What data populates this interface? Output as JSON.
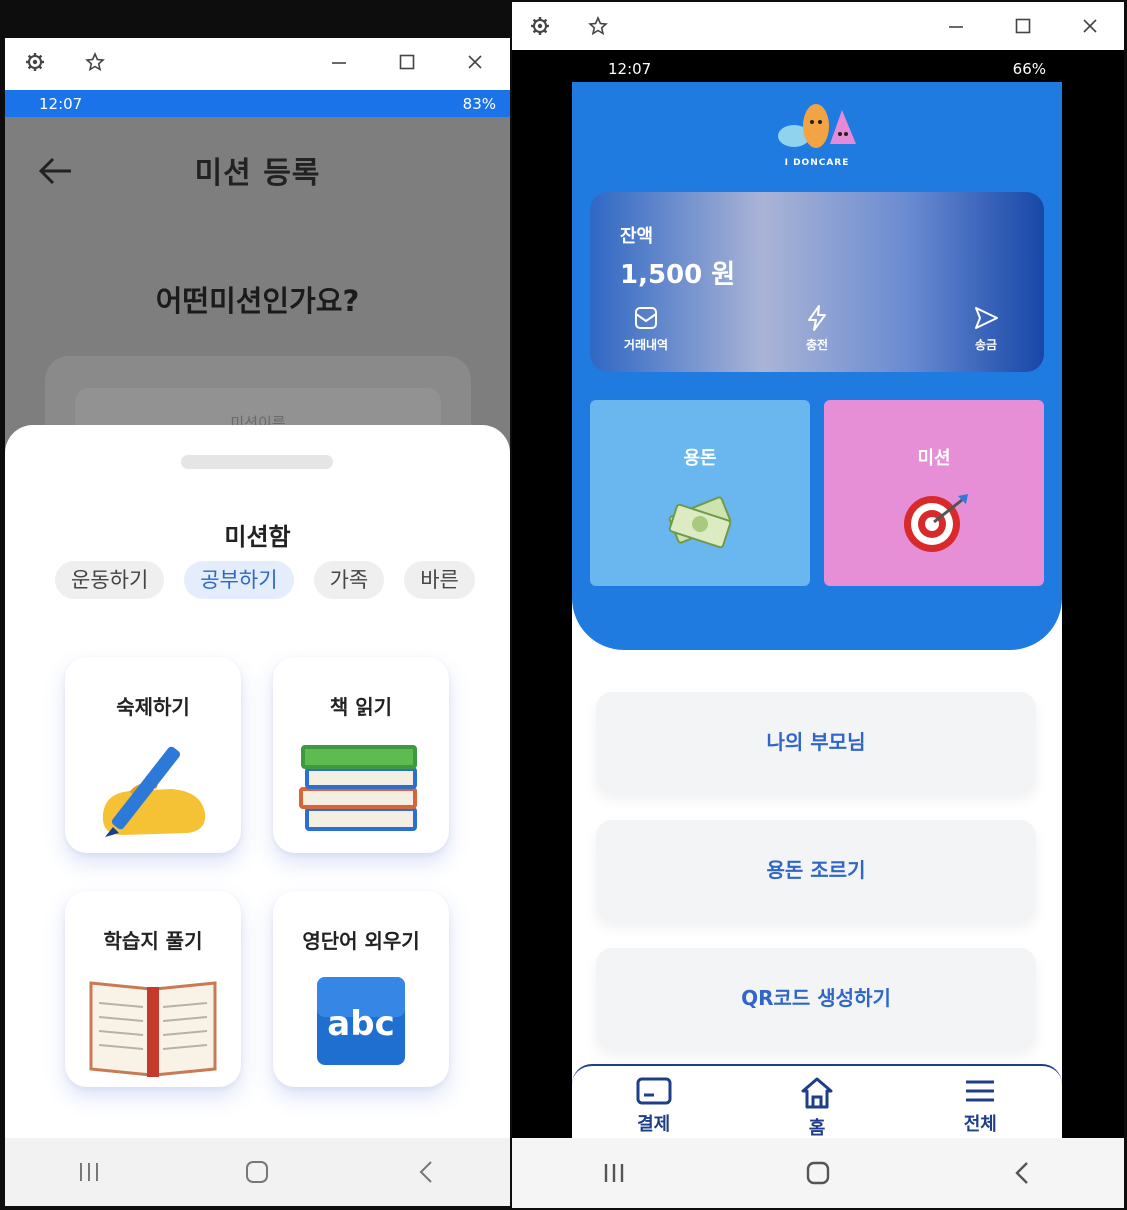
{
  "left": {
    "status": {
      "time": "12:07",
      "battery": "83%"
    },
    "header": {
      "title": "미션 등록"
    },
    "question": "어떤미션인가요?",
    "name_placeholder": "미션이름",
    "sheet": {
      "title": "미션함",
      "categories": [
        {
          "label": "운동하기",
          "active": false
        },
        {
          "label": "공부하기",
          "active": true
        },
        {
          "label": "가족",
          "active": false
        },
        {
          "label": "바른",
          "active": false
        }
      ],
      "missions": [
        {
          "label": "숙제하기",
          "icon": "writing-hand-icon"
        },
        {
          "label": "책 읽기",
          "icon": "books-icon"
        },
        {
          "label": "학습지 풀기",
          "icon": "open-book-icon"
        },
        {
          "label": "영단어 외우기",
          "icon": "abc-icon"
        }
      ]
    }
  },
  "right": {
    "status": {
      "time": "12:07",
      "battery": "66%"
    },
    "logo_text": "I DONCARE",
    "balance": {
      "label": "잔액",
      "amount": "1,500 원",
      "actions": [
        "거래내역",
        "충전",
        "송금"
      ]
    },
    "tiles": [
      {
        "label": "용돈",
        "color": "#6ab7f0",
        "icon": "money-icon"
      },
      {
        "label": "미션",
        "color": "#e68fd6",
        "icon": "target-icon"
      }
    ],
    "menu": [
      "나의 부모님",
      "용돈 조르기",
      "QR코드 생성하기"
    ],
    "tabs": [
      "결제",
      "홈",
      "전체"
    ]
  }
}
